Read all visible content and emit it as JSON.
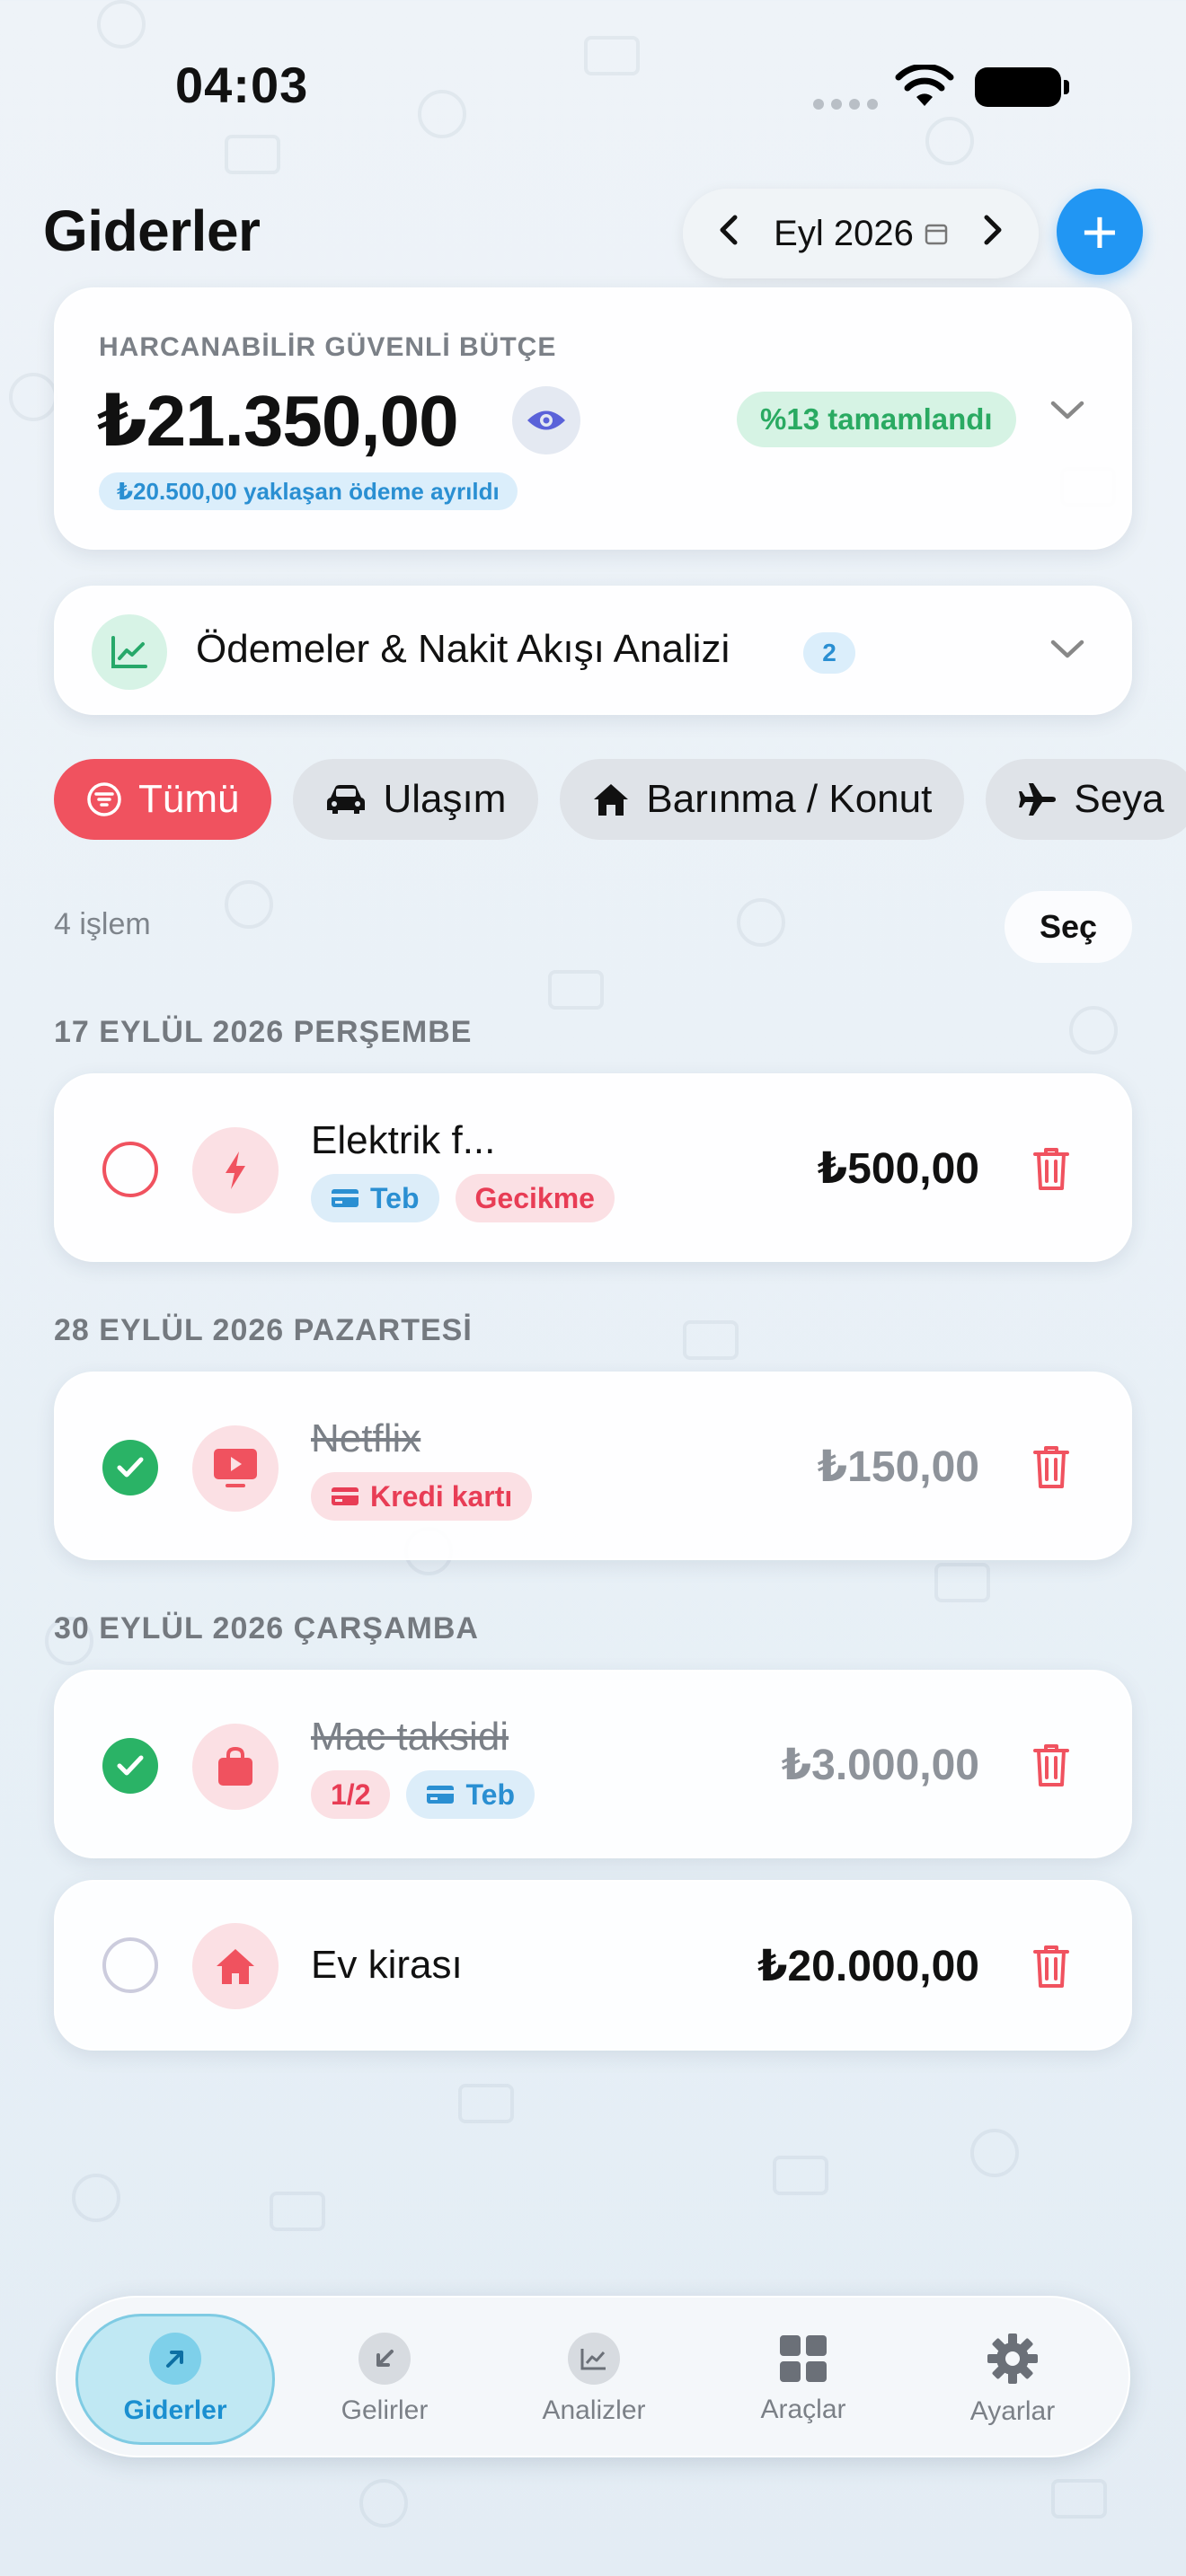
{
  "status_bar": {
    "time": "04:03"
  },
  "header": {
    "title": "Giderler",
    "month_label": "Eyl 2026",
    "add_label": "+"
  },
  "budget": {
    "caption": "HARCANABİLİR GÜVENLİ BÜTÇE",
    "amount": "₺21.350,00",
    "percent_badge": "%13 tamamlandı",
    "note": "₺20.500,00 yaklaşan ödeme ayrıldı"
  },
  "analysis": {
    "label": "Ödemeler & Nakit Akışı Analizi",
    "count": "2"
  },
  "filters": [
    {
      "label": "Tümü",
      "icon": "filter-icon",
      "active": true
    },
    {
      "label": "Ulaşım",
      "icon": "car-icon",
      "active": false
    },
    {
      "label": "Barınma / Konut",
      "icon": "house-icon",
      "active": false
    },
    {
      "label": "Seya",
      "icon": "airplane-icon",
      "active": false
    }
  ],
  "list": {
    "count_label": "4 işlem",
    "select_label": "Seç"
  },
  "groups": [
    {
      "date": "17 EYLÜL 2026 PERŞEMBE",
      "items": [
        {
          "name": "Elektrik f...",
          "amount": "₺500,00",
          "status": "overdue",
          "category_icon": "bolt-icon",
          "tags": [
            {
              "label": "Teb",
              "style": "blue",
              "icon": "card-icon"
            },
            {
              "label": "Gecikme",
              "style": "red"
            }
          ]
        }
      ]
    },
    {
      "date": "28 EYLÜL 2026 PAZARTESİ",
      "items": [
        {
          "name": "Netflix",
          "amount": "₺150,00",
          "status": "paid",
          "category_icon": "tv-play-icon",
          "tags": [
            {
              "label": "Kredi kartı",
              "style": "red",
              "icon": "card-icon"
            }
          ]
        }
      ]
    },
    {
      "date": "30 EYLÜL 2026 ÇARŞAMBA",
      "items": [
        {
          "name": "Mac taksidi",
          "amount": "₺3.000,00",
          "status": "paid",
          "category_icon": "bag-icon",
          "tags": [
            {
              "label": "1/2",
              "style": "red"
            },
            {
              "label": "Teb",
              "style": "blue",
              "icon": "card-icon"
            }
          ]
        },
        {
          "name": "Ev kirası",
          "amount": "₺20.000,00",
          "status": "pending",
          "category_icon": "house-icon",
          "tags": []
        }
      ]
    }
  ],
  "tabbar": [
    {
      "label": "Giderler",
      "icon": "arrow-up-right-icon",
      "active": true
    },
    {
      "label": "Gelirler",
      "icon": "arrow-down-left-icon",
      "active": false
    },
    {
      "label": "Analizler",
      "icon": "chart-icon",
      "active": false
    },
    {
      "label": "Araçlar",
      "icon": "grid-icon",
      "active": false
    },
    {
      "label": "Ayarlar",
      "icon": "gear-icon",
      "active": false
    }
  ],
  "colors": {
    "accent_blue": "#2196f3",
    "danger_red": "#f0525f",
    "success_green": "#2ab366"
  }
}
